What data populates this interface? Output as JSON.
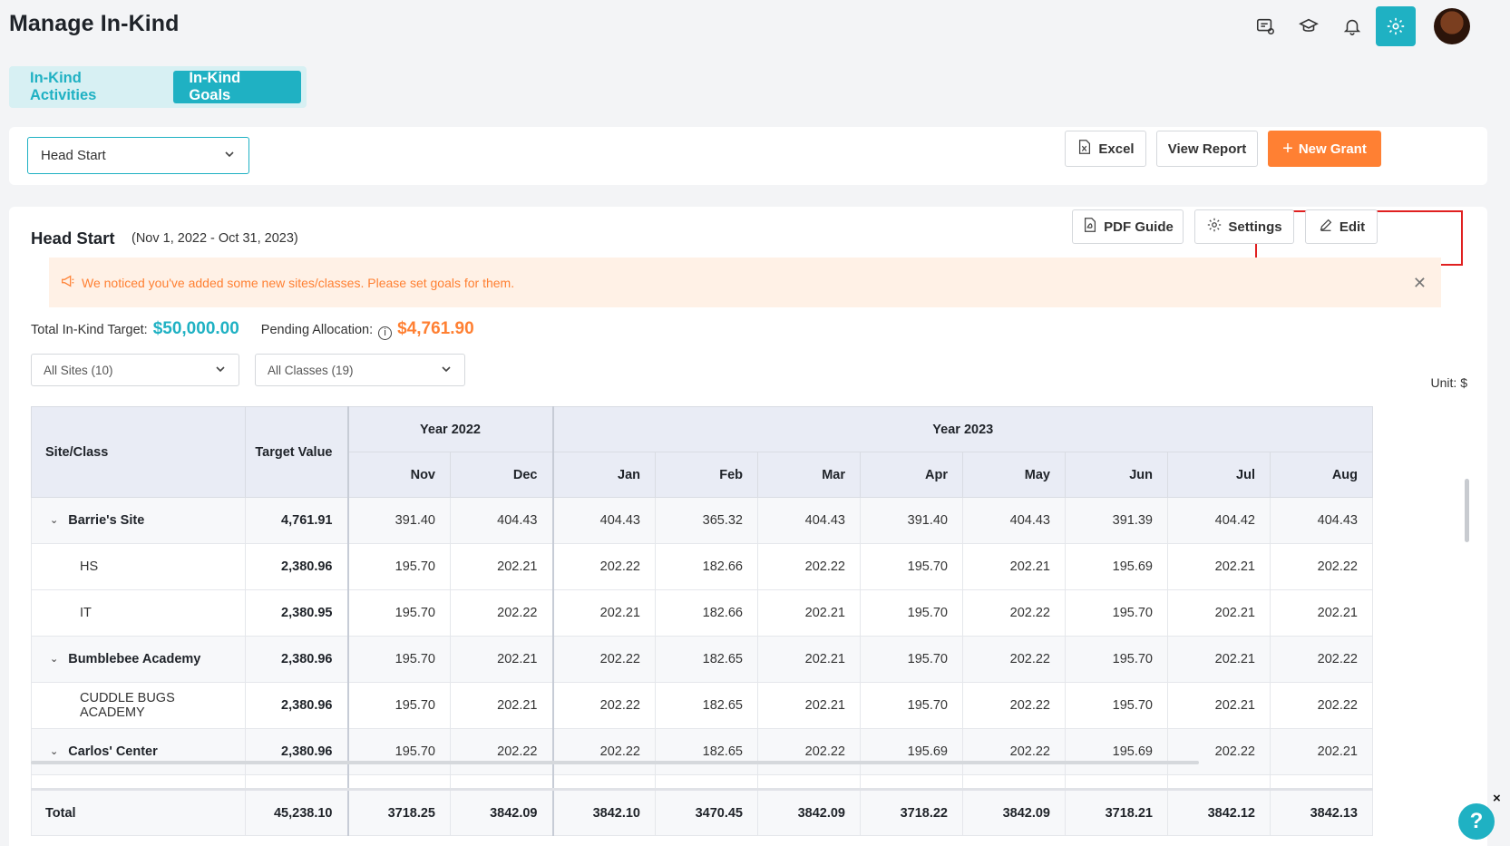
{
  "header": {
    "title": "Manage In-Kind",
    "icons": [
      "message-icon",
      "graduation-cap-icon",
      "bell-icon",
      "gear-icon",
      "avatar"
    ]
  },
  "tabs": [
    {
      "label": "In-Kind Activities",
      "active": false
    },
    {
      "label": "In-Kind Goals",
      "active": true
    }
  ],
  "filter_bar": {
    "program_select": "Head Start",
    "excel_label": "Excel",
    "view_report_label": "View Report",
    "new_grant_label": "New Grant"
  },
  "card": {
    "title": "Head Start",
    "date_range": "(Nov 1, 2022 - Oct 31, 2023)",
    "pdf_guide_label": "PDF Guide",
    "settings_label": "Settings",
    "edit_label": "Edit",
    "notice": "We noticed you've added some new sites/classes. Please set goals for them.",
    "total_target_label": "Total In-Kind Target:",
    "total_target_value": "$50,000.00",
    "pending_label": "Pending Allocation:",
    "pending_value": "$4,761.90",
    "sites_filter": "All Sites (10)",
    "classes_filter": "All Classes (19)",
    "unit": "Unit: $"
  },
  "table": {
    "col_site": "Site/Class",
    "col_target": "Target Value",
    "year_2022": "Year 2022",
    "year_2023": "Year 2023",
    "months": [
      "Nov",
      "Dec",
      "Jan",
      "Feb",
      "Mar",
      "Apr",
      "May",
      "Jun",
      "Jul",
      "Aug"
    ],
    "rows": [
      {
        "name": "Barrie's Site",
        "type": "site",
        "target": "4,761.91",
        "values": [
          "391.40",
          "404.43",
          "404.43",
          "365.32",
          "404.43",
          "391.40",
          "404.43",
          "391.39",
          "404.42",
          "404.43"
        ]
      },
      {
        "name": "HS",
        "type": "class",
        "target": "2,380.96",
        "values": [
          "195.70",
          "202.21",
          "202.22",
          "182.66",
          "202.22",
          "195.70",
          "202.21",
          "195.69",
          "202.21",
          "202.22"
        ]
      },
      {
        "name": "IT",
        "type": "class",
        "target": "2,380.95",
        "values": [
          "195.70",
          "202.22",
          "202.21",
          "182.66",
          "202.21",
          "195.70",
          "202.22",
          "195.70",
          "202.21",
          "202.21"
        ]
      },
      {
        "name": "Bumblebee Academy",
        "type": "site",
        "target": "2,380.96",
        "values": [
          "195.70",
          "202.21",
          "202.22",
          "182.65",
          "202.21",
          "195.70",
          "202.22",
          "195.70",
          "202.21",
          "202.22"
        ]
      },
      {
        "name": "CUDDLE BUGS ACADEMY",
        "type": "class",
        "target": "2,380.96",
        "values": [
          "195.70",
          "202.21",
          "202.22",
          "182.65",
          "202.21",
          "195.70",
          "202.22",
          "195.70",
          "202.21",
          "202.22"
        ]
      },
      {
        "name": "Carlos' Center",
        "type": "site",
        "target": "2,380.96",
        "values": [
          "195.70",
          "202.22",
          "202.22",
          "182.65",
          "202.22",
          "195.69",
          "202.22",
          "195.69",
          "202.22",
          "202.21"
        ]
      }
    ],
    "total": {
      "name": "Total",
      "target": "45,238.10",
      "values": [
        "3718.25",
        "3842.09",
        "3842.10",
        "3470.45",
        "3842.09",
        "3718.22",
        "3842.09",
        "3718.21",
        "3842.12",
        "3842.13"
      ]
    }
  },
  "help": {
    "label": "?",
    "close": "×"
  }
}
